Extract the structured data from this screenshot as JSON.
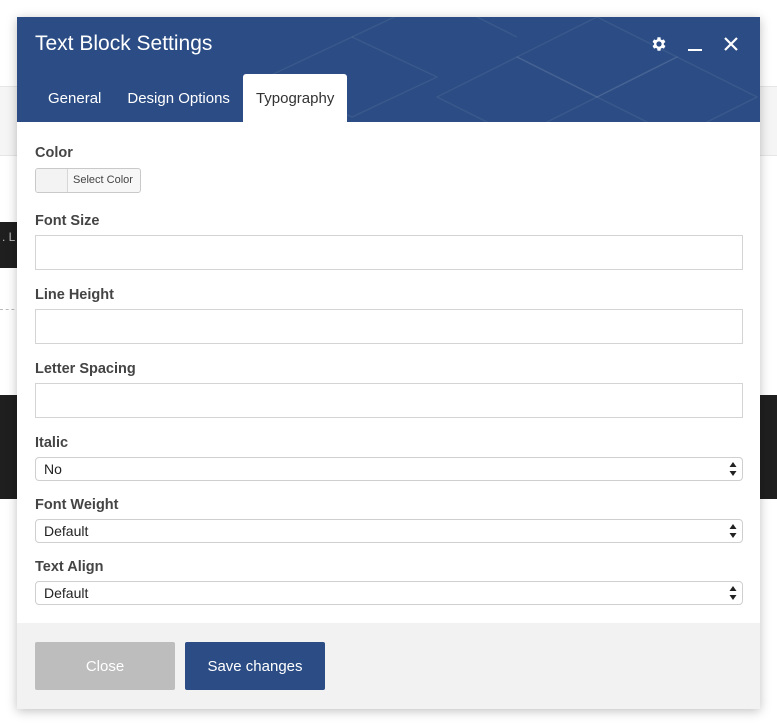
{
  "background": {
    "fragment_text": ". L"
  },
  "modal": {
    "title": "Text Block Settings",
    "controls": {
      "settings": "gear-icon",
      "minimize": "minimize-icon",
      "close": "close-icon"
    },
    "tabs": [
      {
        "label": "General",
        "active": false
      },
      {
        "label": "Design Options",
        "active": false
      },
      {
        "label": "Typography",
        "active": true
      }
    ],
    "fields": {
      "color": {
        "label": "Color",
        "button_label": "Select Color"
      },
      "font_size": {
        "label": "Font Size",
        "value": ""
      },
      "line_height": {
        "label": "Line Height",
        "value": ""
      },
      "letter_spacing": {
        "label": "Letter Spacing",
        "value": ""
      },
      "italic": {
        "label": "Italic",
        "value": "No"
      },
      "font_weight": {
        "label": "Font Weight",
        "value": "Default"
      },
      "text_align": {
        "label": "Text Align",
        "value": "Default"
      }
    },
    "footer": {
      "close_label": "Close",
      "save_label": "Save changes"
    }
  },
  "colors": {
    "header": "#2b4c84",
    "save_button": "#2b4c84",
    "close_button": "#bdbdbd"
  }
}
